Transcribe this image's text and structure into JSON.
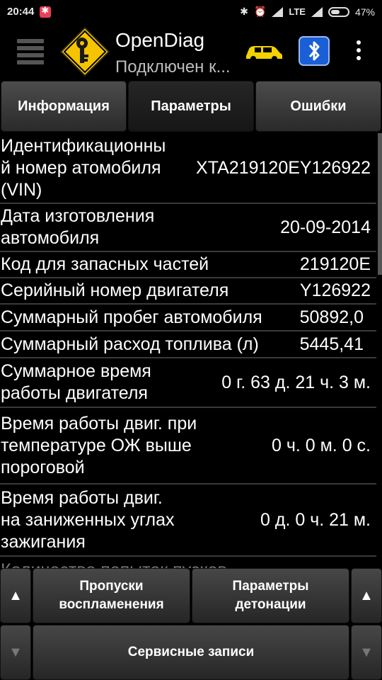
{
  "status_bar": {
    "time": "20:44",
    "network": "LTE",
    "battery": "47%"
  },
  "app": {
    "title": "OpenDiag",
    "subtitle": "Подключен к..."
  },
  "tabs": [
    {
      "label": "Информация",
      "active": false
    },
    {
      "label": "Параметры",
      "active": true
    },
    {
      "label": "Ошибки",
      "active": false
    }
  ],
  "rows": [
    {
      "label": "Идентификационны\nй номер атомобиля\n(VIN)",
      "value": "XTA219120EY126922"
    },
    {
      "label": "Дата изготовления\nавтомобиля",
      "value": "20-09-2014"
    },
    {
      "label": "Код для запасных частей",
      "value": "219120E"
    },
    {
      "label": "Серийный номер двигателя",
      "value": "Y126922"
    },
    {
      "label": "Суммарный пробег автомобиля",
      "value": "50892,0"
    },
    {
      "label": "Суммарный расход топлива (л)",
      "value": "5445,41"
    },
    {
      "label": "Суммарное время\nработы двигателя",
      "value": "0 г. 63 д. 21 ч. 3 м."
    },
    {
      "label": "Время работы двиг. при\nтемпературе ОЖ выше\nпороговой",
      "value": "0 ч. 0 м. 0 с."
    },
    {
      "label": "Время работы двиг.\nна заниженных углах\nзажигания",
      "value": "0 д. 0 ч. 21 м."
    },
    {
      "label": "Количество попыток пусков",
      "value": ""
    }
  ],
  "bottom": {
    "misfire_label": "Пропуски\nвоспламенения",
    "detonation_label": "Параметры\nдетонации",
    "service_label": "Сервисные записи",
    "up_arrow": "▲",
    "down_arrow": "▼"
  },
  "colors": {
    "background": "#000000",
    "logo_yellow": "#f5c400",
    "car_yellow": "#f2d200",
    "bluetooth_blue": "#1a5fd6"
  }
}
